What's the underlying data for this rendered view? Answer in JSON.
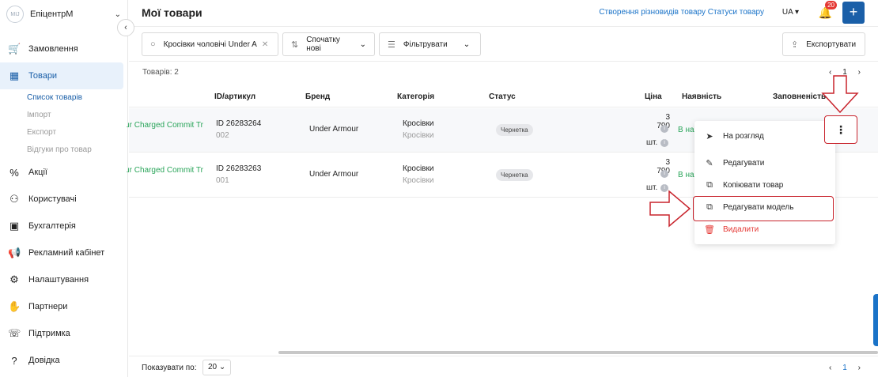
{
  "sidebar": {
    "logo_text": "MIJ",
    "company": "ЕпіцентрМ",
    "items": [
      {
        "label": "Замовлення",
        "icon": "cart-icon"
      },
      {
        "label": "Товари",
        "icon": "box-icon"
      },
      {
        "label": "Акції",
        "icon": "promo-icon"
      },
      {
        "label": "Користувачі",
        "icon": "users-icon"
      },
      {
        "label": "Бухгалтерія",
        "icon": "wallet-icon"
      },
      {
        "label": "Рекламний кабінет",
        "icon": "megaphone-icon"
      },
      {
        "label": "Налаштування",
        "icon": "gear-icon"
      },
      {
        "label": "Партнери",
        "icon": "handshake-icon"
      },
      {
        "label": "Підтримка",
        "icon": "support-icon"
      },
      {
        "label": "Довідка",
        "icon": "help-icon"
      }
    ],
    "sub_items": [
      "Список товарів",
      "Імпорт",
      "Експорт",
      "Відгуки про товар"
    ]
  },
  "header": {
    "title": "Мої товари",
    "link_variants": "Створення різновидів товару",
    "link_statuses": "Статуси товару",
    "lang": "UA",
    "notif_count": "20",
    "add_label": "+"
  },
  "toolbar": {
    "search_value": "Кросівки чоловічі Under A",
    "sort_label": "Спочатку нові",
    "filter_label": "Фільтрувати",
    "export_label": "Експортувати"
  },
  "table": {
    "count_label": "Товарів: 2",
    "page": "1",
    "columns": {
      "id": "ID/артикул",
      "brand": "Бренд",
      "category": "Категорія",
      "status": "Статус",
      "price": "Ціна",
      "availability": "Наявність",
      "fill": "Заповненість"
    },
    "rows": [
      {
        "name": "Under Armour Charged Commit Tr",
        "id": "ID 26283264",
        "sku": "002",
        "brand": "Under Armour",
        "category": "Кросівки",
        "category_sub": "Кросівки",
        "status": "Чернетка",
        "price": "3 790",
        "unit": "шт.",
        "availability": "В наявності"
      },
      {
        "name": "Under Armour Charged Commit Tr",
        "id": "ID 26283263",
        "sku": "001",
        "brand": "Under Armour",
        "category": "Кросівки",
        "category_sub": "Кросівки",
        "status": "Чернетка",
        "price": "3 790",
        "unit": "шт.",
        "availability": "В наявності"
      }
    ]
  },
  "menu": {
    "items": [
      {
        "label": "На розгляд",
        "icon": "send-icon"
      },
      {
        "label": "Редагувати",
        "icon": "pencil-icon"
      },
      {
        "label": "Копіювати товар",
        "icon": "copy-icon"
      },
      {
        "label": "Редагувати модель",
        "icon": "copy-model-icon"
      },
      {
        "label": "Видалити",
        "icon": "trash-icon"
      }
    ]
  },
  "footer": {
    "show_label": "Показувати по:",
    "per_page": "20",
    "page": "1"
  },
  "colors": {
    "accent": "#1a5fa8",
    "link": "#1a73c8",
    "success": "#2aa55a",
    "danger": "#e53935",
    "annotation": "#c8232c"
  }
}
